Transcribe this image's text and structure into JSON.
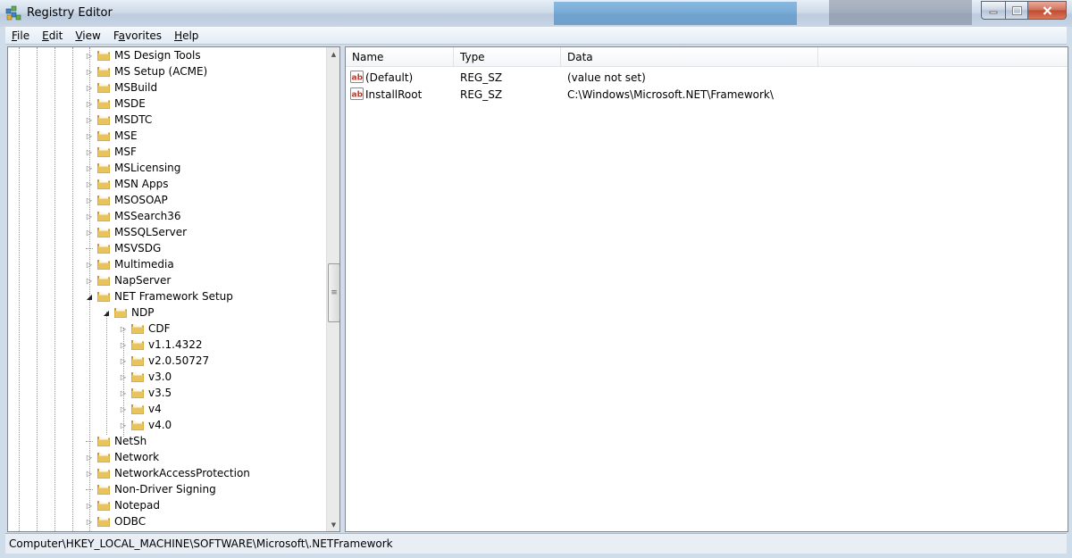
{
  "window": {
    "title": "Registry Editor"
  },
  "menu": [
    {
      "label": "File",
      "key": "F",
      "rest": "ile"
    },
    {
      "label": "Edit",
      "key": "E",
      "rest": "dit"
    },
    {
      "label": "View",
      "key": "V",
      "rest": "iew"
    },
    {
      "label": "Favorites",
      "key": "a",
      "pre": "F",
      "rest": "vorites"
    },
    {
      "label": "Help",
      "key": "H",
      "rest": "elp"
    }
  ],
  "tree": [
    {
      "label": "MS Design Tools",
      "level": 0,
      "expander": "collapsed"
    },
    {
      "label": "MS Setup (ACME)",
      "level": 0,
      "expander": "collapsed"
    },
    {
      "label": "MSBuild",
      "level": 0,
      "expander": "collapsed"
    },
    {
      "label": "MSDE",
      "level": 0,
      "expander": "collapsed"
    },
    {
      "label": "MSDTC",
      "level": 0,
      "expander": "collapsed"
    },
    {
      "label": "MSE",
      "level": 0,
      "expander": "collapsed"
    },
    {
      "label": "MSF",
      "level": 0,
      "expander": "collapsed"
    },
    {
      "label": "MSLicensing",
      "level": 0,
      "expander": "collapsed"
    },
    {
      "label": "MSN Apps",
      "level": 0,
      "expander": "collapsed"
    },
    {
      "label": "MSOSOAP",
      "level": 0,
      "expander": "collapsed"
    },
    {
      "label": "MSSearch36",
      "level": 0,
      "expander": "collapsed"
    },
    {
      "label": "MSSQLServer",
      "level": 0,
      "expander": "collapsed"
    },
    {
      "label": "MSVSDG",
      "level": 0,
      "expander": "none"
    },
    {
      "label": "Multimedia",
      "level": 0,
      "expander": "collapsed"
    },
    {
      "label": "NapServer",
      "level": 0,
      "expander": "collapsed"
    },
    {
      "label": "NET Framework Setup",
      "level": 0,
      "expander": "expanded"
    },
    {
      "label": "NDP",
      "level": 1,
      "expander": "expanded"
    },
    {
      "label": "CDF",
      "level": 2,
      "expander": "collapsed"
    },
    {
      "label": "v1.1.4322",
      "level": 2,
      "expander": "collapsed"
    },
    {
      "label": "v2.0.50727",
      "level": 2,
      "expander": "collapsed"
    },
    {
      "label": "v3.0",
      "level": 2,
      "expander": "collapsed"
    },
    {
      "label": "v3.5",
      "level": 2,
      "expander": "collapsed"
    },
    {
      "label": "v4",
      "level": 2,
      "expander": "collapsed"
    },
    {
      "label": "v4.0",
      "level": 2,
      "expander": "collapsed"
    },
    {
      "label": "NetSh",
      "level": 0,
      "expander": "none"
    },
    {
      "label": "Network",
      "level": 0,
      "expander": "collapsed"
    },
    {
      "label": "NetworkAccessProtection",
      "level": 0,
      "expander": "collapsed"
    },
    {
      "label": "Non-Driver Signing",
      "level": 0,
      "expander": "none"
    },
    {
      "label": "Notepad",
      "level": 0,
      "expander": "collapsed"
    },
    {
      "label": "ODBC",
      "level": 0,
      "expander": "collapsed"
    }
  ],
  "list": {
    "columns": [
      "Name",
      "Type",
      "Data"
    ],
    "rows": [
      {
        "name": "(Default)",
        "type": "REG_SZ",
        "data": "(value not set)",
        "icon": "string-value-icon"
      },
      {
        "name": "InstallRoot",
        "type": "REG_SZ",
        "data": "C:\\Windows\\Microsoft.NET\\Framework\\",
        "icon": "string-value-icon"
      }
    ]
  },
  "status": {
    "path": "Computer\\HKEY_LOCAL_MACHINE\\SOFTWARE\\Microsoft\\.NETFramework"
  },
  "colors": {
    "folder": "#e8c45a",
    "folder_dark": "#c99a2a",
    "string_icon_red": "#c0392b"
  }
}
